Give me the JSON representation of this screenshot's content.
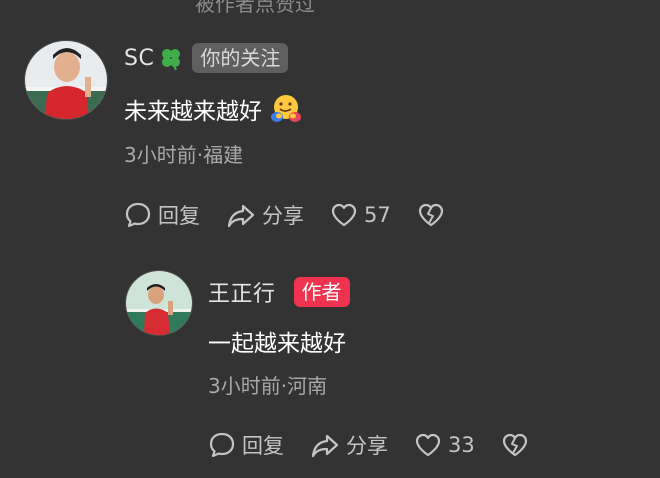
{
  "top_cut_text": "被作者点赞过",
  "comments": [
    {
      "username": "SC",
      "badge": "你的关注",
      "text": "未来越来越好",
      "meta": "3小时前·福建",
      "reply_label": "回复",
      "share_label": "分享",
      "likes": "57"
    },
    {
      "username": "王正行",
      "badge": "作者",
      "text": "一起越来越好",
      "meta": "3小时前·河南",
      "reply_label": "回复",
      "share_label": "分享",
      "likes": "33"
    }
  ],
  "colors": {
    "background": "#333333",
    "author_badge": "#f0334f",
    "follow_badge": "#5f5f5f",
    "meta_text": "#a8a8a8"
  },
  "icons": [
    "clover-icon",
    "hugging-face-emoji",
    "reply-bubble-icon",
    "share-arrow-icon",
    "heart-icon",
    "broken-heart-icon"
  ]
}
